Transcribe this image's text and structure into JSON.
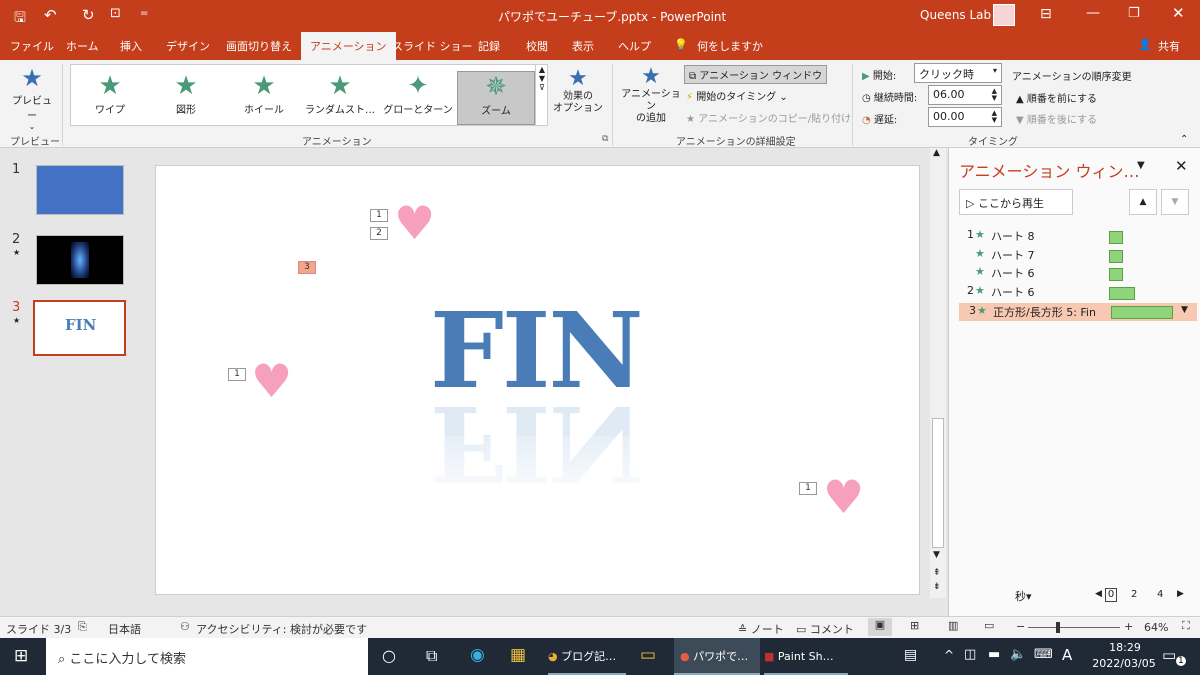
{
  "title": {
    "qat_more": "=",
    "doc": "パワポでユーチューブ.pptx",
    "separator": "-",
    "app": "PowerPoint",
    "user": "Queens Lab"
  },
  "tabs": [
    "ファイル",
    "ホーム",
    "挿入",
    "デザイン",
    "画面切り替え",
    "アニメーション",
    "スライド ショー",
    "記録",
    "校閲",
    "表示",
    "ヘルプ",
    "何をしますか"
  ],
  "share": "共有",
  "ribbon": {
    "preview_label": "プレビュー",
    "preview_group": "プレビュー",
    "gallery": [
      "ワイプ",
      "図形",
      "ホイール",
      "ランダムスト…",
      "グローとターン",
      "ズーム"
    ],
    "effect_options": "効果の\nオプション",
    "animation_group": "アニメーション",
    "add_animation": "アニメーション\nの追加",
    "animation_pane": "アニメーション ウィンドウ",
    "trigger": "開始のタイミング",
    "painter": "アニメーションのコピー/貼り付け",
    "advanced_group": "アニメーションの詳細設定",
    "start_label": "開始:",
    "start_value": "クリック時",
    "duration_label": "継続時間:",
    "duration_value": "06.00",
    "delay_label": "遅延:",
    "delay_value": "00.00",
    "reorder_title": "アニメーションの順序変更",
    "move_earlier": "順番を前にする",
    "move_later": "順番を後にする",
    "timing_group": "タイミング"
  },
  "thumbnails": [
    "1",
    "2",
    "3"
  ],
  "slide": {
    "fin_text": "FIN",
    "tags": [
      "1",
      "2",
      "3",
      "1",
      "1"
    ]
  },
  "pane": {
    "title": "アニメーション ウィン…",
    "play_from": "ここから再生",
    "rows": [
      {
        "num": "1",
        "name": "ハート 8"
      },
      {
        "num": "",
        "name": "ハート 7"
      },
      {
        "num": "",
        "name": "ハート 6"
      },
      {
        "num": "2",
        "name": "ハート 6"
      },
      {
        "num": "3",
        "name": "正方形/長方形 5: Fin"
      }
    ],
    "seconds": "秒",
    "timeline": [
      "0",
      "2",
      "4"
    ]
  },
  "status": {
    "slide": "スライド 3/3",
    "lang": "日本語",
    "access": "アクセシビリティ: 検討が必要です",
    "notes": "ノート",
    "comments": "コメント",
    "zoom": "64%"
  },
  "taskbar": {
    "search": "ここに入力して検索",
    "apps": [
      "ブログ記…",
      "パワポで…",
      "Paint Sh…"
    ],
    "ime": "A",
    "time": "18:29",
    "date": "2022/03/05",
    "notif": "1"
  },
  "colors": {
    "accent": "#c43e1c",
    "star": "#4a9a7a",
    "bar": "#8fd47a"
  }
}
